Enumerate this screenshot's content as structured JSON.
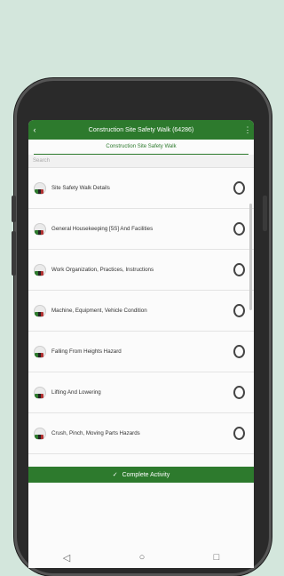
{
  "appbar": {
    "back": "‹",
    "title": "Construction Site Safety Walk (64286)",
    "more": "⋮"
  },
  "subtitle": "Construction Site Safety Walk",
  "search": {
    "placeholder": "Search"
  },
  "items": [
    {
      "label": "Site Safety Walk Details"
    },
    {
      "label": "General Housekeeping [5S] And Facilities"
    },
    {
      "label": "Work Organization, Practices, Instructions"
    },
    {
      "label": "Machine, Equipment, Vehicle Condition"
    },
    {
      "label": "Falling From Heights Hazard"
    },
    {
      "label": "Lifting And Lowering"
    },
    {
      "label": "Crush, Pinch, Moving Parts Hazards"
    }
  ],
  "complete_button": {
    "icon": "✓",
    "label": "Complete Activity"
  },
  "navbar": {
    "back": "◁",
    "home": "○",
    "recents": "□"
  }
}
